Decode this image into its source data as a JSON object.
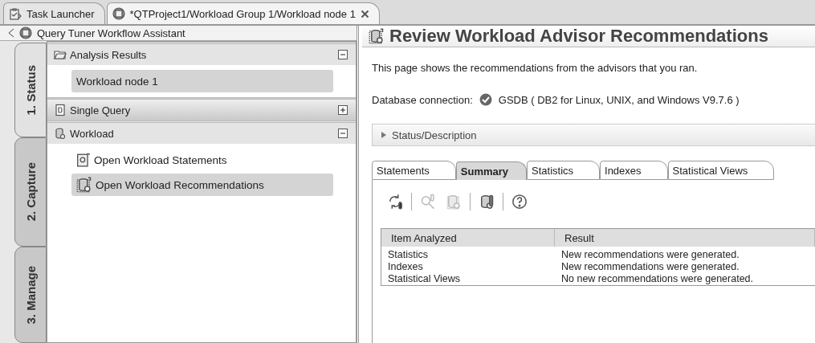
{
  "editor_tabs": [
    {
      "label": "Task Launcher",
      "kind": "launcher",
      "selected": false
    },
    {
      "label": "*QTProject1/Workload Group 1/Workload node 1",
      "kind": "project",
      "selected": true
    }
  ],
  "assistant": {
    "title": "Query Tuner Workflow Assistant"
  },
  "side_tabs": [
    {
      "label": "1. Status",
      "selected": true
    },
    {
      "label": "2. Capture",
      "selected": false
    },
    {
      "label": "3. Manage",
      "selected": false
    }
  ],
  "sections": [
    {
      "title": "Analysis Results",
      "kind": "folder",
      "expanded": true,
      "items": [
        {
          "label": "Workload node 1",
          "kind": "plain",
          "selected": true
        }
      ]
    },
    {
      "title": "Single Query",
      "kind": "query",
      "expanded": false
    },
    {
      "title": "Workload",
      "kind": "workload",
      "expanded": true,
      "items": [
        {
          "label": "Open Workload Statements",
          "kind": "statements",
          "selected": false
        },
        {
          "label": "Open Workload Recommendations",
          "kind": "recommendations",
          "selected": true
        }
      ]
    }
  ],
  "page": {
    "title": "Review Workload Advisor Recommendations",
    "description": "This page shows the recommendations from the advisors that you ran.",
    "connection_label": "Database connection:",
    "connection_value": "GSDB ( DB2 for Linux, UNIX, and Windows V9.7.6 )"
  },
  "status_section": {
    "label": "Status/Description",
    "expanded": false
  },
  "result_tabs": [
    {
      "label": "Statements",
      "selected": false
    },
    {
      "label": "Summary",
      "selected": true
    },
    {
      "label": "Statistics",
      "selected": false
    },
    {
      "label": "Indexes",
      "selected": false
    },
    {
      "label": "Statistical Views",
      "selected": false
    }
  ],
  "toolbar": [
    {
      "kind": "refresh",
      "disabled": false
    },
    {
      "kind": "separator"
    },
    {
      "kind": "inspect",
      "disabled": true
    },
    {
      "kind": "document",
      "disabled": true
    },
    {
      "kind": "separator"
    },
    {
      "kind": "database",
      "disabled": false
    },
    {
      "kind": "separator"
    },
    {
      "kind": "help",
      "disabled": false
    }
  ],
  "table": {
    "columns": [
      "Item Analyzed",
      "Result"
    ],
    "rows": [
      [
        "Statistics",
        "New recommendations were generated."
      ],
      [
        "Indexes",
        "New recommendations were generated."
      ],
      [
        "Statistical Views",
        "No new recommendations were generated."
      ]
    ]
  }
}
